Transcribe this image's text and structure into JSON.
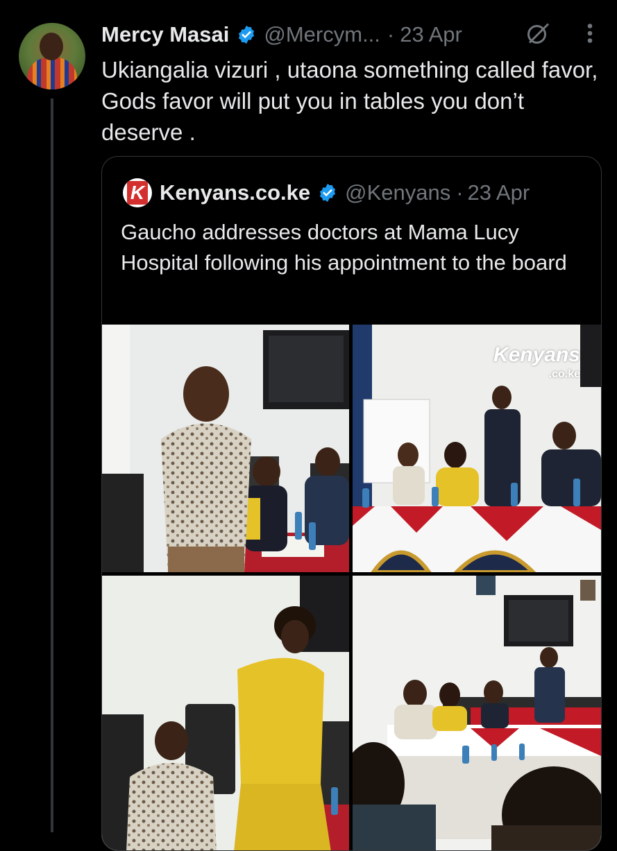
{
  "tweet": {
    "author_name": "Mercy Masai",
    "handle": "@Mercym...",
    "separator": "·",
    "date": "23 Apr",
    "text": "Ukiangalia vizuri , utaona something called favor, Gods favor will put you in tables you don’t deserve ."
  },
  "quote": {
    "author_name": "Kenyans.co.ke",
    "handle": "@Kenyans",
    "separator": "·",
    "date": "23 Apr",
    "text": "Gaucho addresses doctors at Mama Lucy Hospital following his appointment to the board",
    "watermark_main": "Kenyans",
    "watermark_sub": ".co.ke"
  },
  "icons": {
    "verified": "verified-badge-icon",
    "grok": "grok-icon",
    "more": "more-options-icon"
  },
  "colors": {
    "background": "#000000",
    "text": "#e7e9ea",
    "muted": "#71767b",
    "verified": "#1d9bf0",
    "border": "#333639"
  }
}
